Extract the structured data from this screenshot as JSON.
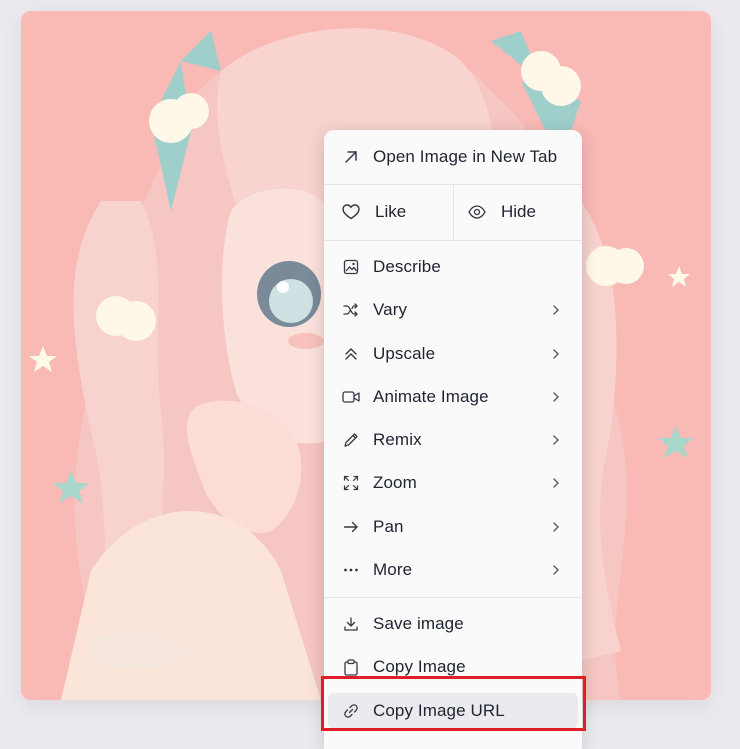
{
  "image": {
    "description_icon": "anime-girl-artwork",
    "background_color": "#f9b9b4"
  },
  "context_menu": {
    "open_new_tab": {
      "label": "Open Image in New Tab",
      "icon": "arrow-up-right-icon"
    },
    "like": {
      "label": "Like",
      "icon": "heart-icon"
    },
    "hide": {
      "label": "Hide",
      "icon": "eye-icon"
    },
    "describe": {
      "label": "Describe",
      "icon": "image-icon"
    },
    "vary": {
      "label": "Vary",
      "icon": "shuffle-icon"
    },
    "upscale": {
      "label": "Upscale",
      "icon": "double-chevron-up-icon"
    },
    "animate_image": {
      "label": "Animate Image",
      "icon": "video-icon"
    },
    "remix": {
      "label": "Remix",
      "icon": "pencil-icon"
    },
    "zoom": {
      "label": "Zoom",
      "icon": "expand-icon"
    },
    "pan": {
      "label": "Pan",
      "icon": "arrow-right-icon"
    },
    "more": {
      "label": "More",
      "icon": "ellipsis-icon"
    },
    "save_image": {
      "label": "Save image",
      "icon": "download-icon"
    },
    "copy_image": {
      "label": "Copy Image",
      "icon": "clipboard-icon"
    },
    "copy_image_url": {
      "label": "Copy Image URL",
      "icon": "link-icon"
    }
  },
  "colors": {
    "highlight": "#e11d27",
    "menu_bg": "#fafafa",
    "hover_bg": "#ebebef"
  }
}
